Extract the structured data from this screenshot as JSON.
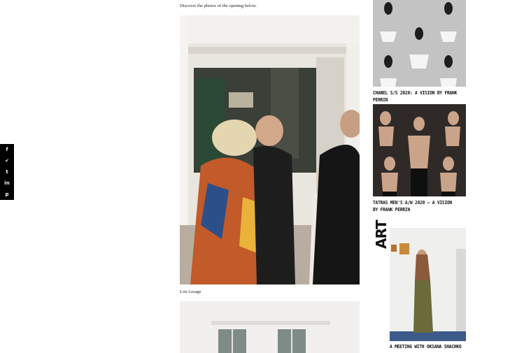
{
  "article": {
    "intro_text": "Discover the photos of the opening below.",
    "photo_caption": "Lou Lesage"
  },
  "share_bar": {
    "buttons": [
      {
        "icon": "facebook-icon",
        "glyph": "f"
      },
      {
        "icon": "twitter-icon",
        "glyph": "✔"
      },
      {
        "icon": "tumblr-icon",
        "glyph": "t"
      },
      {
        "icon": "linkedin-icon",
        "glyph": "in"
      },
      {
        "icon": "pinterest-icon",
        "glyph": "p"
      }
    ]
  },
  "sidebar": {
    "items": [
      {
        "title": "CHANEL S/S 2020: A VISION BY FRANK PERRIN"
      },
      {
        "title": "TATRAS MEN'S A/W 2020 – A VISION BY FRANK PERRIN"
      },
      {
        "section": "ART",
        "title": "A MEETING WITH OKSANA SHACHKO"
      }
    ]
  }
}
